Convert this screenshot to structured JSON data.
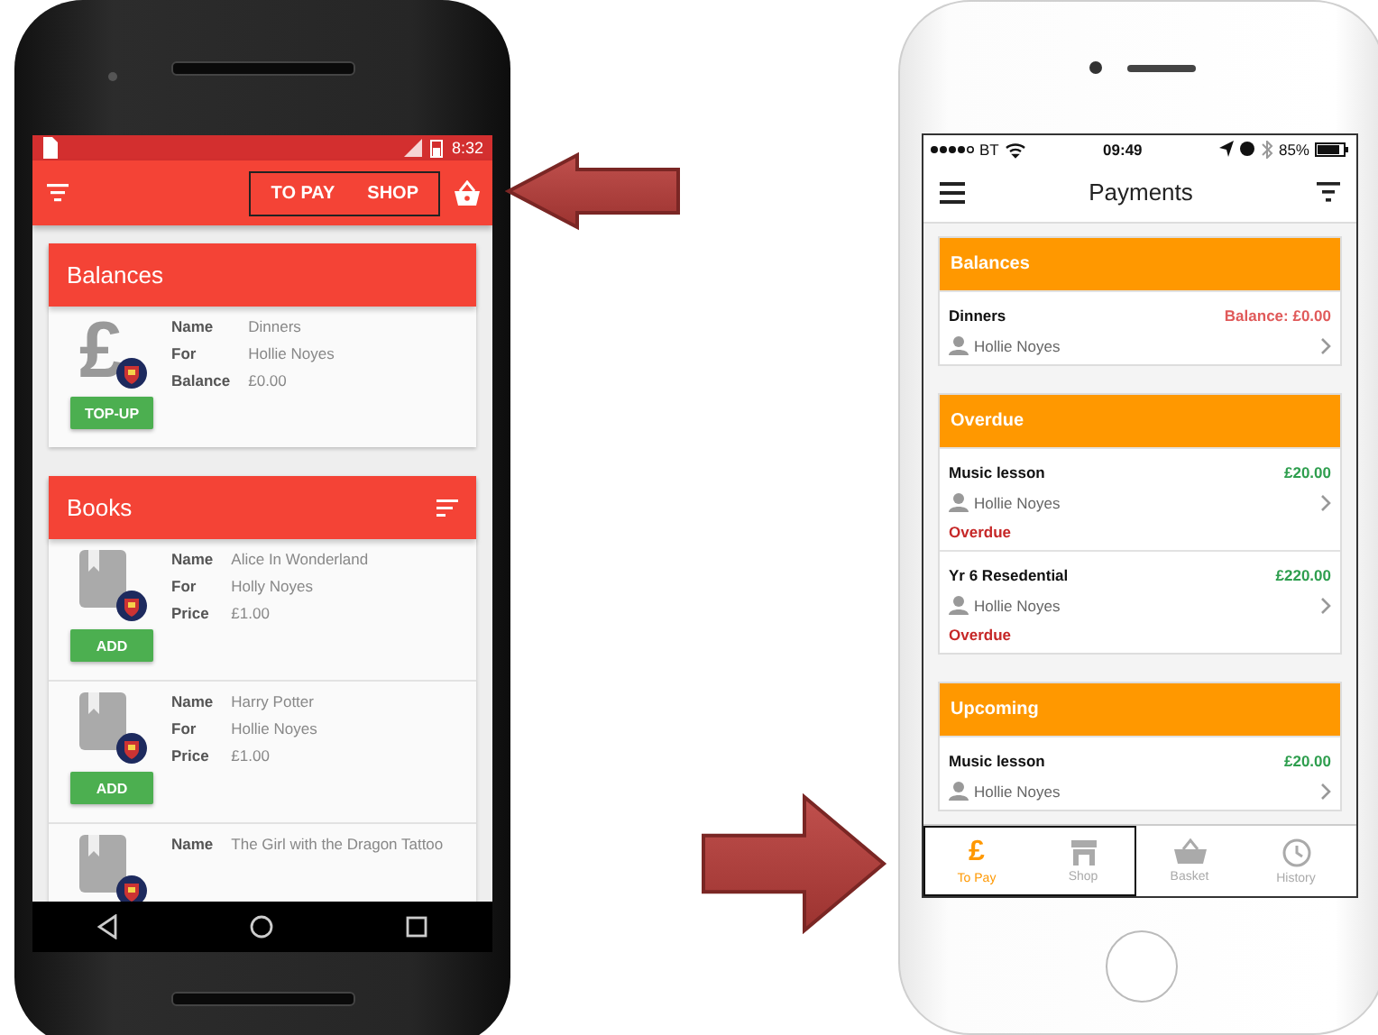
{
  "android": {
    "status_bar": {
      "time": "8:32"
    },
    "toolbar": {
      "tabs": [
        {
          "label": "TO PAY",
          "highlighted": true
        },
        {
          "label": "SHOP",
          "highlighted": true
        }
      ]
    },
    "sections": [
      {
        "title": "Balances",
        "filter": false,
        "items": [
          {
            "kind": "balance",
            "icon": "£",
            "fields": [
              {
                "label": "Name",
                "value": "Dinners"
              },
              {
                "label": "For",
                "value": "Hollie Noyes"
              },
              {
                "label": "Balance",
                "value": "£0.00"
              }
            ],
            "button": "TOP-UP"
          }
        ]
      },
      {
        "title": "Books",
        "filter": true,
        "items": [
          {
            "kind": "book",
            "fields": [
              {
                "label": "Name",
                "value": "Alice In Wonderland"
              },
              {
                "label": "For",
                "value": "Holly Noyes"
              },
              {
                "label": "Price",
                "value": "£1.00"
              }
            ],
            "button": "ADD"
          },
          {
            "kind": "book",
            "fields": [
              {
                "label": "Name",
                "value": "Harry Potter"
              },
              {
                "label": "For",
                "value": "Hollie Noyes"
              },
              {
                "label": "Price",
                "value": "£1.00"
              }
            ],
            "button": "ADD"
          },
          {
            "kind": "book",
            "fields": [
              {
                "label": "Name",
                "value": "The Girl with the Dragon Tattoo"
              }
            ]
          }
        ]
      }
    ]
  },
  "ios": {
    "status_bar": {
      "carrier": "BT",
      "time": "09:49",
      "battery": "85%"
    },
    "nav_bar": {
      "title": "Payments"
    },
    "sections": [
      {
        "title": "Balances",
        "items": [
          {
            "title": "Dinners",
            "amount": "Balance: £0.00",
            "color": "#e05a5a",
            "person": "Hollie Noyes"
          }
        ]
      },
      {
        "title": "Overdue",
        "items": [
          {
            "title": "Music lesson",
            "amount": "£20.00",
            "color": "#2e9e4e",
            "person": "Hollie Noyes",
            "status": "Overdue"
          },
          {
            "title": "Yr 6 Resedential",
            "amount": "£220.00",
            "color": "#2e9e4e",
            "person": "Hollie Noyes",
            "status": "Overdue"
          }
        ]
      },
      {
        "title": "Upcoming",
        "items": [
          {
            "title": "Music lesson",
            "amount": "£20.00",
            "color": "#2e9e4e",
            "person": "Hollie Noyes"
          }
        ]
      }
    ],
    "tab_bar": {
      "tabs": [
        {
          "kind": "pound",
          "icon": "£",
          "label": "To Pay",
          "selected": true,
          "highlighted": true
        },
        {
          "kind": "shop",
          "label": "Shop",
          "selected": false,
          "highlighted": true
        },
        {
          "kind": "basket",
          "label": "Basket",
          "selected": false,
          "highlighted": false
        },
        {
          "kind": "history",
          "label": "History",
          "selected": false,
          "highlighted": false
        }
      ]
    }
  }
}
